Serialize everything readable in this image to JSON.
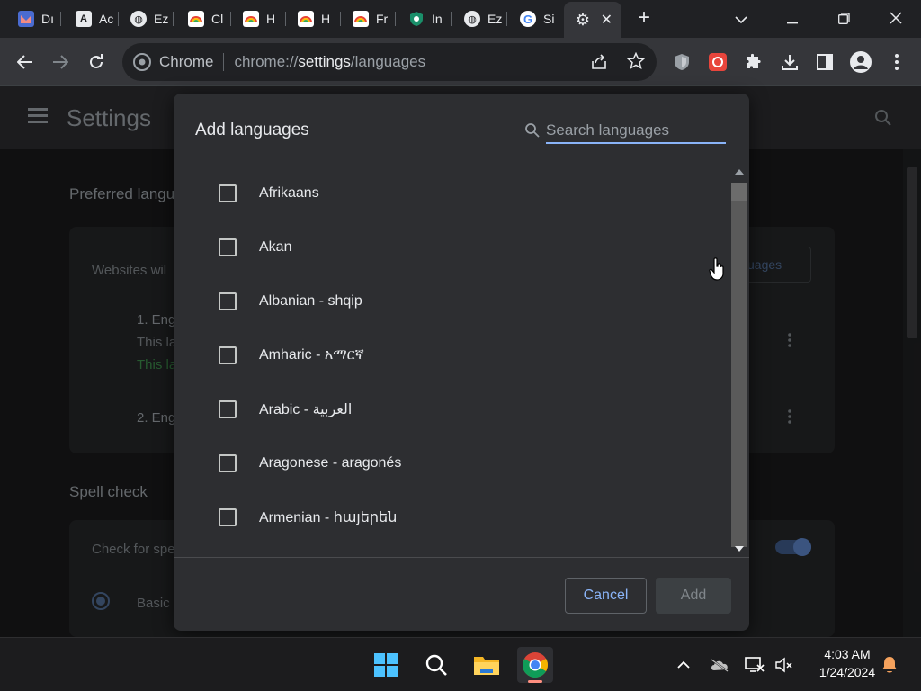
{
  "tabs": [
    {
      "title": "Dı",
      "favicon": "mail-icon",
      "color": "#5b7bd5"
    },
    {
      "title": "Ac",
      "favicon": "app-icon",
      "color": "#e8eaed"
    },
    {
      "title": "Ez",
      "favicon": "globe-icon",
      "color": "#e8eaed"
    },
    {
      "title": "Cl",
      "favicon": "rainbow-icon",
      "color": "#ffffff"
    },
    {
      "title": "H",
      "favicon": "rainbow-icon",
      "color": "#ffffff"
    },
    {
      "title": "H",
      "favicon": "rainbow-icon",
      "color": "#ffffff"
    },
    {
      "title": "Fr",
      "favicon": "rainbow-icon",
      "color": "#ffffff"
    },
    {
      "title": "In",
      "favicon": "shield-icon",
      "color": "#1a8f6a"
    },
    {
      "title": "Ez",
      "favicon": "globe-icon",
      "color": "#e8eaed"
    },
    {
      "title": "Si",
      "favicon": "google-icon",
      "color": "#ffffff"
    }
  ],
  "active_tab": {
    "favicon": "gear-icon",
    "close": "✕"
  },
  "new_tab": "+",
  "toolbar": {
    "site_label": "Chrome",
    "url_prefix": "chrome://",
    "url_bold": "settings",
    "url_suffix": "/languages"
  },
  "settings_page": {
    "title": "Settings",
    "preferred_languages": "Preferred langu",
    "websites_text": "Websites wil",
    "lang1": "1. Eng",
    "lang1_sub1": "This la",
    "lang1_sub2": "This la",
    "lang2": "2. Eng",
    "add_languages_btn": "uages",
    "spell_check": "Spell check",
    "check_for": "Check for spe",
    "basic": "Basic"
  },
  "dialog": {
    "title": "Add languages",
    "search_placeholder": "Search languages",
    "languages": [
      "Afrikaans",
      "Akan",
      "Albanian - shqip",
      "Amharic - አማርኛ",
      "Arabic - العربية",
      "Aragonese - aragonés",
      "Armenian - հայերեն"
    ],
    "cancel_label": "Cancel",
    "add_label": "Add"
  },
  "taskbar": {
    "time": "4:03 AM",
    "date": "1/24/2024"
  },
  "colors": {
    "accent": "#8ab4f8",
    "dialog_bg": "#2d2e31",
    "success_text": "#3c8a4a"
  }
}
